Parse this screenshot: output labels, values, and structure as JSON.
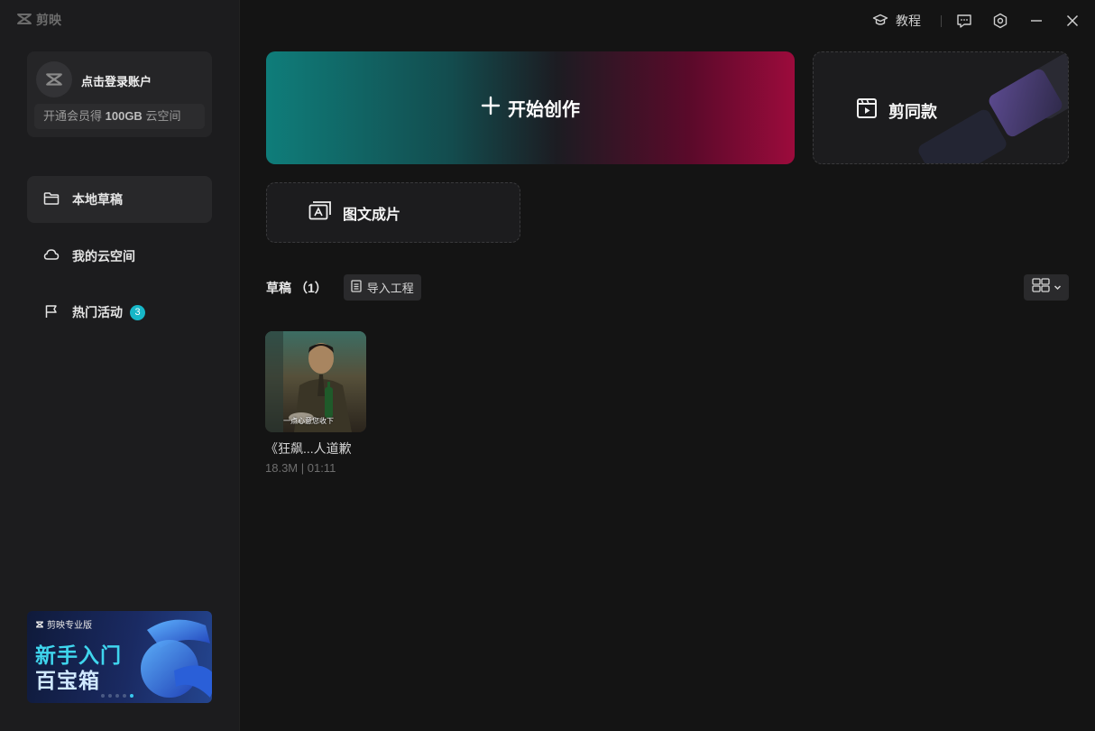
{
  "app": {
    "logo_text": "剪映"
  },
  "account": {
    "login_label": "点击登录账户",
    "vip_prefix": "开通会员得 ",
    "vip_amount": "100GB",
    "vip_suffix": " 云空间"
  },
  "sidebar": {
    "items": [
      {
        "label": "本地草稿",
        "icon": "folder-icon",
        "active": true
      },
      {
        "label": "我的云空间",
        "icon": "cloud-icon",
        "active": false
      },
      {
        "label": "热门活动",
        "icon": "flag-icon",
        "active": false,
        "badge": "3"
      }
    ]
  },
  "banner": {
    "brand": "剪映专业版",
    "line1": "新手入门",
    "line2": "百宝箱"
  },
  "titlebar": {
    "tutorial_label": "教程"
  },
  "main": {
    "start_create_label": "开始创作",
    "template_label": "剪同款",
    "image_to_video_label": "图文成片",
    "drafts_title": "草稿",
    "drafts_count": "（1）",
    "import_label": "导入工程"
  },
  "drafts": [
    {
      "name": "《狂飙...人道歉",
      "meta": "18.3M | 01:11",
      "thumb_caption": "一点心意您收下"
    }
  ],
  "colors": {
    "accent_teal": "#0f7d7a",
    "accent_red": "#9c0b3c",
    "badge": "#17b7c8"
  }
}
